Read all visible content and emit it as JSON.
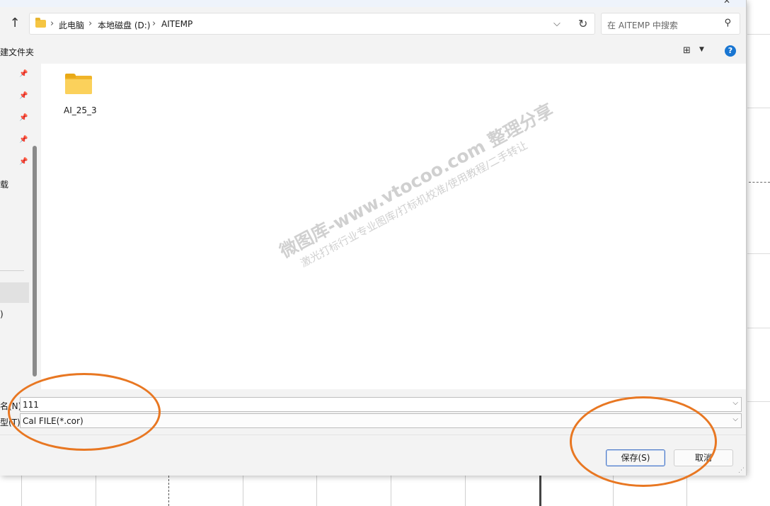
{
  "address": {
    "crumbs": [
      "此电脑",
      "本地磁盘 (D:)",
      "AITEMP"
    ],
    "separator": "›"
  },
  "search": {
    "placeholder": "在 AITEMP 中搜索"
  },
  "toolbar": {
    "new_folder_label": "建文件夹"
  },
  "nav": {
    "partial_labels": [
      "载",
      ")"
    ]
  },
  "files": [
    {
      "name": "AI_25_3",
      "type": "folder"
    }
  ],
  "form": {
    "filename_label": "名(N):",
    "filename_value": "111",
    "filetype_label": "型(T):",
    "filetype_value": "Cal FILE(*.cor)"
  },
  "buttons": {
    "save_label": "保存(S)",
    "cancel_label": "取消"
  },
  "watermark": {
    "line1": "微图库-www.vtocoo.com 整理分享",
    "line2": "激光打标行业专业图库/打标机校准/使用教程/二手转让"
  },
  "colors": {
    "accent": "#1976d2",
    "annotation": "#e87722",
    "folder": "#f0b429"
  },
  "icons": [
    "folder-icon",
    "up-arrow-icon",
    "chevron-down-icon",
    "refresh-icon",
    "search-icon",
    "view-grid-icon",
    "help-icon",
    "pin-icon"
  ]
}
